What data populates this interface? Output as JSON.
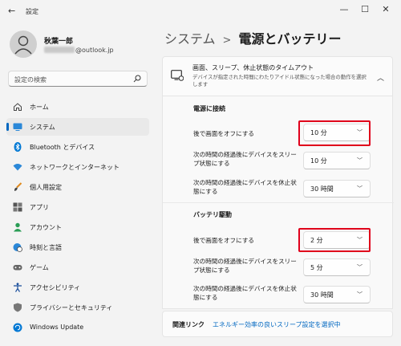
{
  "window": {
    "title": "設定",
    "back_glyph": "←",
    "minimize": "—",
    "maximize": "☐",
    "close": "✕"
  },
  "user": {
    "name": "秋葉一郎",
    "email_suffix": "@outlook.jp"
  },
  "search": {
    "placeholder": "設定の検索"
  },
  "nav": {
    "items": [
      {
        "label": "ホーム",
        "icon": "home-icon"
      },
      {
        "label": "システム",
        "icon": "monitor-icon",
        "active": true
      },
      {
        "label": "Bluetooth とデバイス",
        "icon": "bluetooth-icon"
      },
      {
        "label": "ネットワークとインターネット",
        "icon": "wifi-icon"
      },
      {
        "label": "個人用設定",
        "icon": "brush-icon"
      },
      {
        "label": "アプリ",
        "icon": "apps-icon"
      },
      {
        "label": "アカウント",
        "icon": "person-icon"
      },
      {
        "label": "時刻と言語",
        "icon": "globe-clock-icon"
      },
      {
        "label": "ゲーム",
        "icon": "gamepad-icon"
      },
      {
        "label": "アクセシビリティ",
        "icon": "accessibility-icon"
      },
      {
        "label": "プライバシーとセキュリティ",
        "icon": "shield-icon"
      },
      {
        "label": "Windows Update",
        "icon": "update-icon"
      }
    ],
    "accent_color": "#0067c0"
  },
  "page": {
    "breadcrumb": "システム",
    "separator": ">",
    "title": "電源とバッテリー"
  },
  "screen_sleep": {
    "title": "画面、スリープ、休止状態のタイムアウト",
    "description": "デバイスが指定された時間にわたりアイドル状態になった場合の動作を選択します",
    "plugged_in": {
      "heading": "電源に接続",
      "rows": [
        {
          "label": "後で画面をオフにする",
          "value": "10 分",
          "highlighted": true
        },
        {
          "label": "次の時間の経過後にデバイスをスリープ状態にする",
          "value": "10 分"
        },
        {
          "label": "次の時間の経過後にデバイスを休止状態にする",
          "value": "30 時間"
        }
      ]
    },
    "battery": {
      "heading": "バッテリ駆動",
      "rows": [
        {
          "label": "後で画面をオフにする",
          "value": "2 分",
          "highlighted": true
        },
        {
          "label": "次の時間の経過後にデバイスをスリープ状態にする",
          "value": "5 分"
        },
        {
          "label": "次の時間の経過後にデバイスを休止状態にする",
          "value": "30 時間"
        }
      ]
    }
  },
  "related": {
    "label": "関連リンク",
    "link": "エネルギー効率の良いスリープ設定を選択中"
  },
  "colors": {
    "highlight": "#e0001b",
    "link": "#0067c0"
  }
}
